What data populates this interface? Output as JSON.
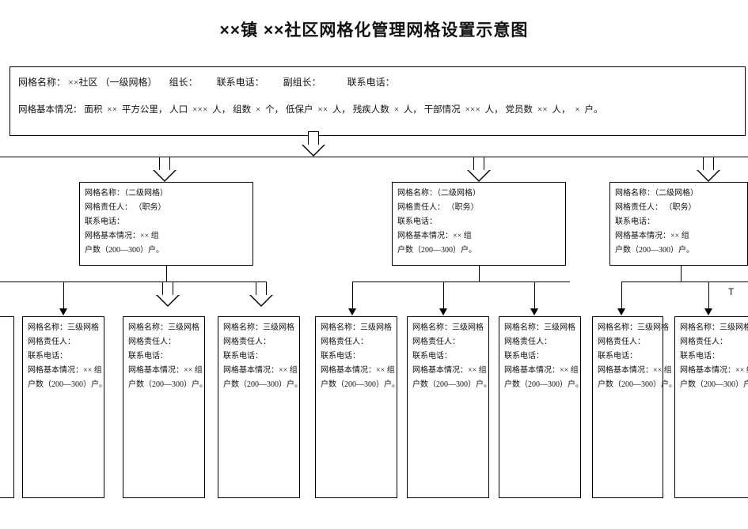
{
  "title": "××镇  ××社区网格化管理网格设置示意图",
  "header": {
    "row1": {
      "grid_name_label": "网格名称：",
      "grid_name_value": "××社区 （一级网格）",
      "leader_label": "组长：",
      "leader_phone_label": "联系电话：",
      "deputy_label": "副组长：",
      "deputy_phone_label": "联系电话："
    },
    "row2": {
      "basic_label": "网格基本情况：",
      "area_label": "面积",
      "area_value": "××",
      "area_unit": "平方公里，",
      "pop_label": "人口",
      "pop_value": "×××",
      "pop_unit": "人，",
      "group_label": "组数",
      "group_value": "×",
      "group_unit": "个，",
      "dibao_label": "低保户",
      "dibao_value": "××",
      "dibao_unit": "人，",
      "disabled_label": "残疾人数",
      "disabled_value": "×",
      "disabled_unit": "人，",
      "cadre_label": "干部情况",
      "cadre_value": "×××",
      "cadre_unit": "人，",
      "party_label": "党员数",
      "party_value": "××",
      "party_unit": "人，",
      "hh_value": "×",
      "hh_unit": "户。"
    }
  },
  "level2": {
    "name_label": "网格名称：（二级网格）",
    "owner_label": "网格责任人：  （职务）",
    "phone_label": "联系电话：",
    "basic_label": "网格基本情况：×× 组",
    "hh_label": "户数（200—300）户。"
  },
  "level3": {
    "name_label": "网格名称：三级网格",
    "owner_label": "网格责任人：",
    "phone_label": "联系电话：",
    "basic_label": "网格基本情况：×× 组",
    "hh_label": "户数（200—300）户。"
  },
  "tmark": "T"
}
